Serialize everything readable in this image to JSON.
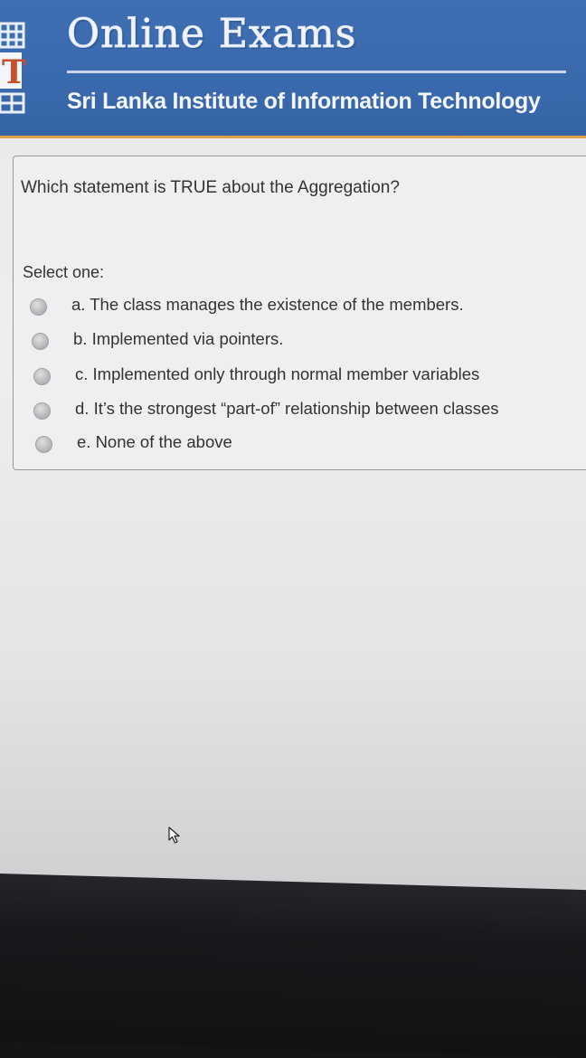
{
  "header": {
    "title": "Online Exams",
    "subtitle": "Sri Lanka Institute of Information Technology",
    "logo_letter": "T",
    "colors": {
      "banner": "#3a69ad",
      "accent_line": "#e3a24a"
    }
  },
  "question": {
    "text": "Which statement is TRUE about the Aggregation?",
    "prompt": "Select one:",
    "options": [
      {
        "label": "a. The class manages the existence of the members.",
        "selected": false
      },
      {
        "label": "b. Implemented via pointers.",
        "selected": false
      },
      {
        "label": "c. Implemented only through normal member variables",
        "selected": false
      },
      {
        "label": "d. It’s the strongest “part-of” relationship between classes",
        "selected": false
      },
      {
        "label": "e. None of the above",
        "selected": false
      }
    ]
  },
  "icons": {
    "logo": "institute-logo-icon",
    "cursor": "mouse-pointer-icon"
  }
}
